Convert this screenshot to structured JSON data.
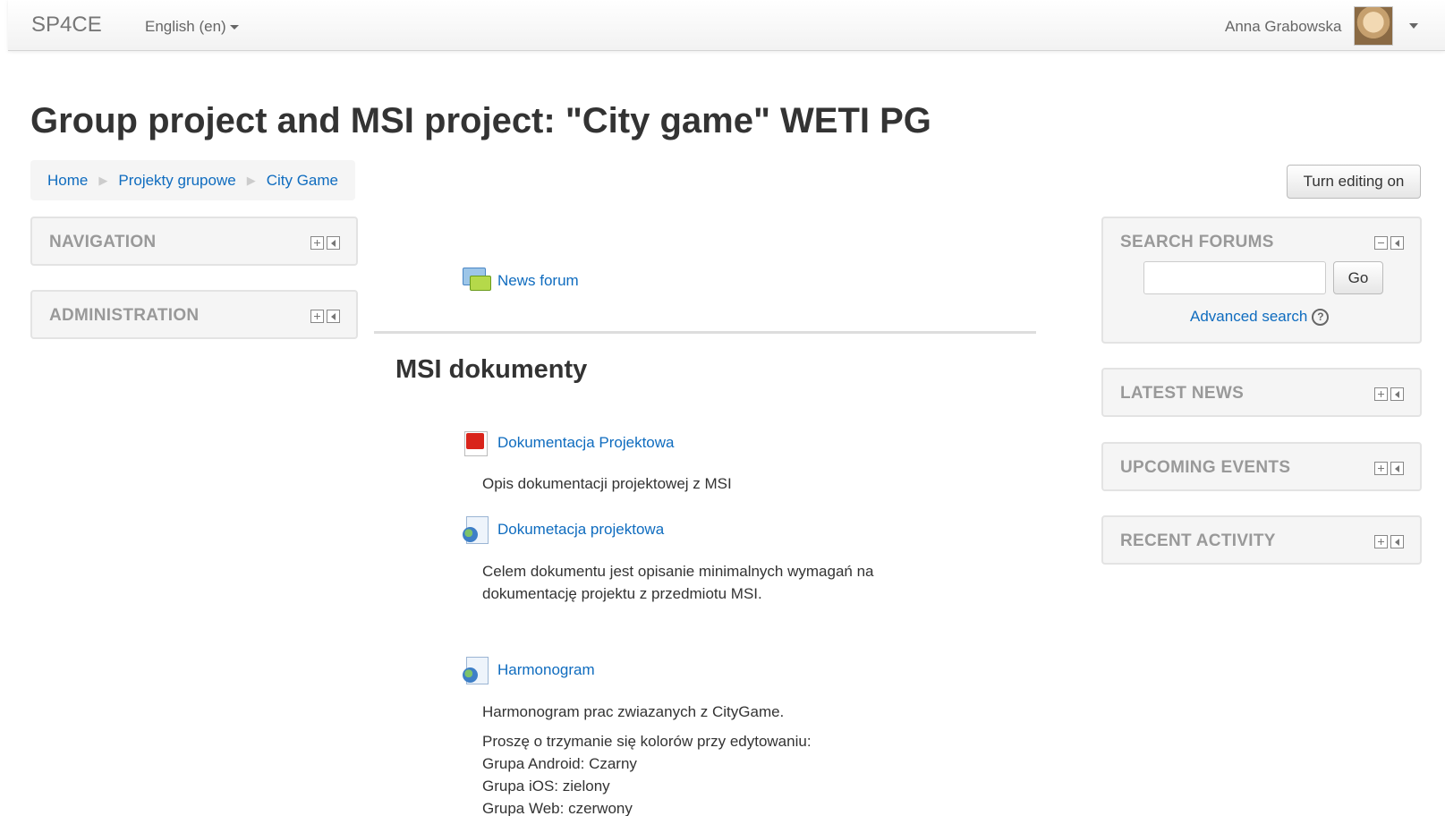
{
  "navbar": {
    "brand": "SP4CE",
    "language": "English (en)",
    "user_name": "Anna Grabowska"
  },
  "page": {
    "title": "Group project and MSI project: \"City game\" WETI PG",
    "edit_button": "Turn editing on"
  },
  "breadcrumb": [
    "Home",
    "Projekty grupowe",
    "City Game"
  ],
  "left_blocks": [
    {
      "title": "NAVIGATION"
    },
    {
      "title": "ADMINISTRATION"
    }
  ],
  "search_forums": {
    "title": "SEARCH FORUMS",
    "input_value": "",
    "go_label": "Go",
    "advanced_label": "Advanced search"
  },
  "right_blocks": [
    {
      "title": "LATEST NEWS"
    },
    {
      "title": "UPCOMING EVENTS"
    },
    {
      "title": "RECENT ACTIVITY"
    }
  ],
  "main": {
    "news_forum": "News forum",
    "section_title": "MSI dokumenty",
    "activities": [
      {
        "name": "Dokumentacja Projektowa",
        "icon": "pdf-icon",
        "summary": [
          "Opis dokumentacji projektowej z MSI"
        ]
      },
      {
        "name": "Dokumetacja projektowa",
        "icon": "url-icon",
        "summary": [
          "Celem dokumentu jest opisanie minimalnych wymagań na",
          "dokumentację projektu z przedmiotu MSI."
        ]
      },
      {
        "name": "Harmonogram",
        "icon": "url-icon",
        "summary": [
          "Harmonogram prac zwiazanych z CityGame."
        ]
      }
    ],
    "harmonogram_notes": [
      "Proszę o trzymanie się kolorów przy edytowaniu:",
      "Grupa Android: Czarny",
      "Grupa iOS: zielony",
      "Grupa Web: czerwony"
    ]
  }
}
